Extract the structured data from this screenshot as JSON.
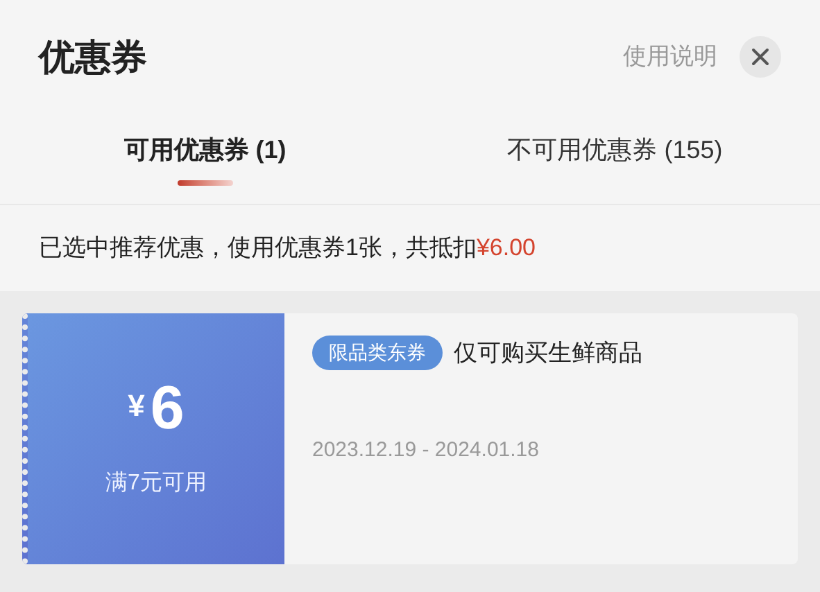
{
  "header": {
    "title": "优惠券",
    "help_link": "使用说明"
  },
  "tabs": [
    {
      "label": "可用优惠券 (1)",
      "selected": true
    },
    {
      "label": "不可用优惠券 (155)",
      "selected": false
    }
  ],
  "summary": {
    "text": "已选中推荐优惠，使用优惠券1张，共抵扣",
    "amount": "¥6.00"
  },
  "coupons": [
    {
      "currency": "¥",
      "value": "6",
      "condition": "满7元可用",
      "tag": "限品类东券",
      "description": "仅可购买生鲜商品",
      "validity": "2023.12.19 - 2024.01.18"
    }
  ]
}
